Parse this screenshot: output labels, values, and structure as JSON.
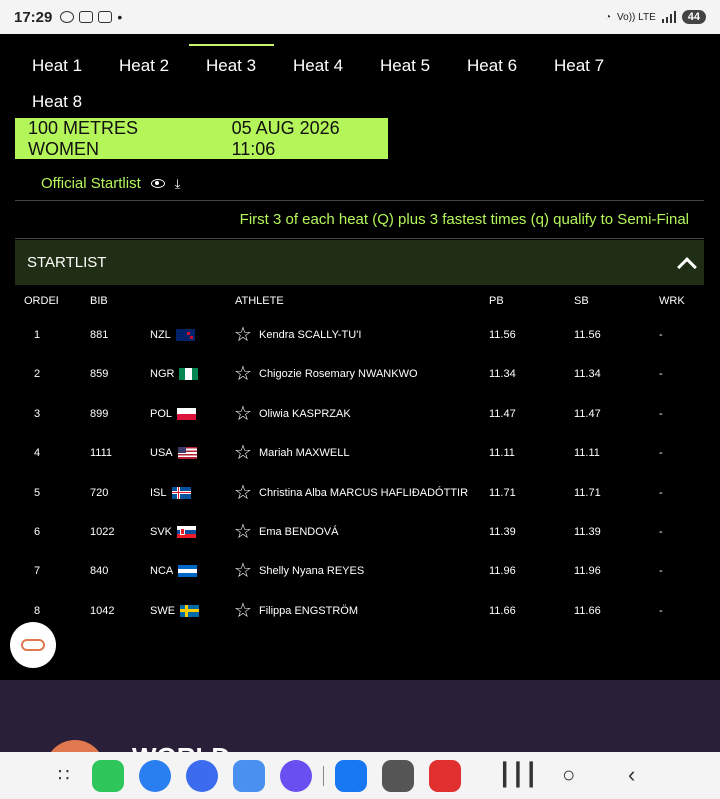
{
  "status": {
    "time": "17:29",
    "battery": "44",
    "net": "Vo)) LTE"
  },
  "tabs": [
    "Heat 1",
    "Heat 2",
    "Heat 3",
    "Heat 4",
    "Heat 5",
    "Heat 6",
    "Heat 7",
    "Heat 8"
  ],
  "active_tab": 2,
  "banner": {
    "event": "100 METRES WOMEN",
    "datetime": "05 AUG 2026 11:06"
  },
  "startlist_link": "Official Startlist",
  "qualify_text": "First 3 of each heat (Q) plus 3 fastest times (q) qualify to Semi-Final",
  "section_title": "STARTLIST",
  "columns": {
    "order": "ORDER",
    "bib": "BIB",
    "athlete": "ATHLETE",
    "pb": "PB",
    "sb": "SB",
    "wrk": "WRK"
  },
  "rows": [
    {
      "order": "1",
      "bib": "881",
      "nat": "NZL",
      "athlete": "Kendra SCALLY-TU'I",
      "pb": "11.56",
      "sb": "11.56",
      "wrk": "-"
    },
    {
      "order": "2",
      "bib": "859",
      "nat": "NGR",
      "athlete": "Chigozie Rosemary NWANKWO",
      "pb": "11.34",
      "sb": "11.34",
      "wrk": "-"
    },
    {
      "order": "3",
      "bib": "899",
      "nat": "POL",
      "athlete": "Oliwia KASPRZAK",
      "pb": "11.47",
      "sb": "11.47",
      "wrk": "-"
    },
    {
      "order": "4",
      "bib": "1111",
      "nat": "USA",
      "athlete": "Mariah MAXWELL",
      "pb": "11.11",
      "sb": "11.11",
      "wrk": "-"
    },
    {
      "order": "5",
      "bib": "720",
      "nat": "ISL",
      "athlete": "Christina Alba MARCUS HAFLIÐADÓTTIR",
      "pb": "11.71",
      "sb": "11.71",
      "wrk": "-"
    },
    {
      "order": "6",
      "bib": "1022",
      "nat": "SVK",
      "athlete": "Ema BENDOVÁ",
      "pb": "11.39",
      "sb": "11.39",
      "wrk": "-"
    },
    {
      "order": "7",
      "bib": "840",
      "nat": "NCA",
      "athlete": "Shelly Nyana REYES",
      "pb": "11.96",
      "sb": "11.96",
      "wrk": "-"
    },
    {
      "order": "8",
      "bib": "1042",
      "nat": "SWE",
      "athlete": "Filippa ENGSTRÖM",
      "pb": "11.66",
      "sb": "11.66",
      "wrk": "-"
    }
  ],
  "colors": {
    "accent": "#b4f55a",
    "header_bg": "#1f2e14",
    "footer_bg": "#2a1f38",
    "fab_ring": "#e07850"
  },
  "footer_logo_text": "WORLD"
}
